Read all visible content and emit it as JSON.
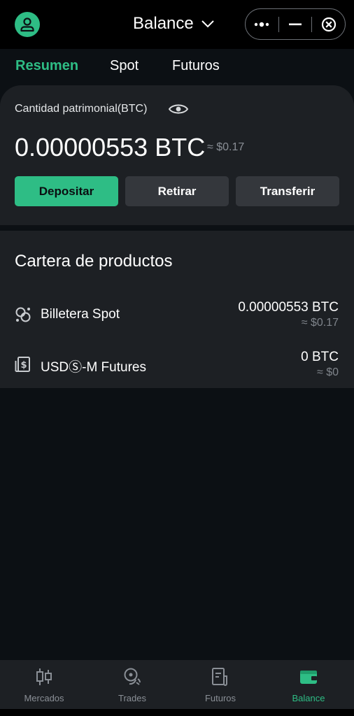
{
  "header": {
    "title": "Balance",
    "avatar_icon": "user-icon",
    "more_icon": "more-dots-icon",
    "minimize_icon": "minimize-icon",
    "close_icon": "close-circle-icon"
  },
  "tabs": [
    {
      "label": "Resumen",
      "active": true
    },
    {
      "label": "Spot",
      "active": false
    },
    {
      "label": "Futuros",
      "active": false
    }
  ],
  "summary": {
    "label": "Cantidad patrimonial(BTC)",
    "amount": "0.00000553 BTC",
    "amount_usd": "≈ $0.17",
    "buttons": {
      "deposit": "Depositar",
      "withdraw": "Retirar",
      "transfer": "Transferir"
    }
  },
  "products": {
    "title": "Cartera de productos",
    "items": [
      {
        "name": "Billetera Spot",
        "btc": "0.00000553 BTC",
        "usd": "≈ $0.17",
        "icon": "spot-wallet-icon"
      },
      {
        "name": "USDⓈ-M Futures",
        "btc": "0 BTC",
        "usd": "≈ $0",
        "icon": "futures-dollar-icon"
      }
    ]
  },
  "bottom_nav": [
    {
      "label": "Mercados",
      "icon": "candlestick-icon",
      "active": false
    },
    {
      "label": "Trades",
      "icon": "trades-icon",
      "active": false
    },
    {
      "label": "Futuros",
      "icon": "futures-icon",
      "active": false
    },
    {
      "label": "Balance",
      "icon": "wallet-icon",
      "active": true
    }
  ],
  "colors": {
    "accent": "#2ebd85",
    "background": "#0c1014",
    "card": "#1d2024",
    "button_secondary": "#34373c",
    "muted_text": "#8a8f96"
  }
}
